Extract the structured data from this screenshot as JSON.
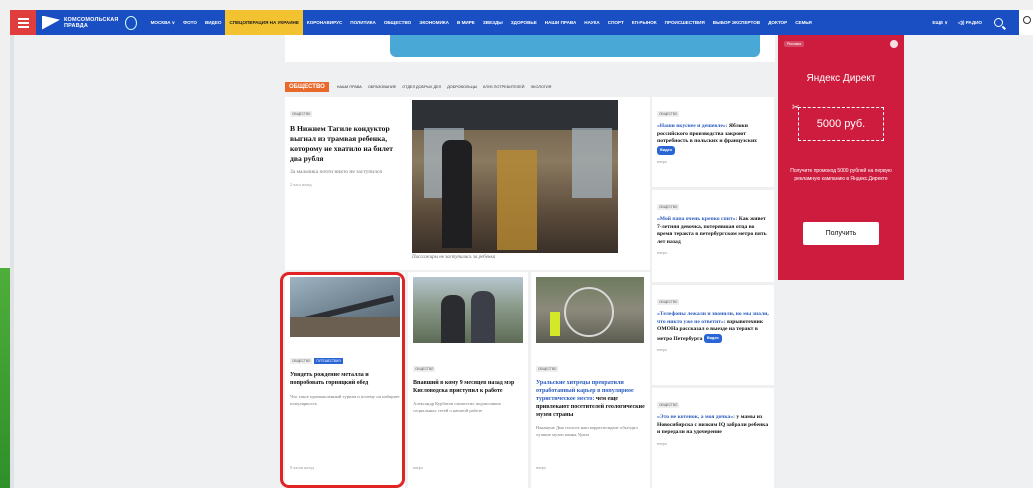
{
  "nav": {
    "items": [
      {
        "label": "Москва ∨",
        "hl": false
      },
      {
        "label": "Фото",
        "hl": false
      },
      {
        "label": "Видео",
        "hl": false
      },
      {
        "label": "Спецоперация на Украине",
        "hl": true
      },
      {
        "label": "Коронавирус",
        "hl": false
      },
      {
        "label": "Политика",
        "hl": false
      },
      {
        "label": "Общество",
        "hl": false
      },
      {
        "label": "Экономика",
        "hl": false
      },
      {
        "label": "В мире",
        "hl": false
      },
      {
        "label": "Звезды",
        "hl": false
      },
      {
        "label": "Здоровье",
        "hl": false
      },
      {
        "label": "Наши права",
        "hl": false
      },
      {
        "label": "Наука",
        "hl": false
      },
      {
        "label": "Спорт",
        "hl": false
      },
      {
        "label": "Кп-рынок",
        "hl": false
      },
      {
        "label": "Происшествия",
        "hl": false
      },
      {
        "label": "Выбор экспертов",
        "hl": false
      },
      {
        "label": "Доктор",
        "hl": false
      },
      {
        "label": "Семья",
        "hl": false
      }
    ],
    "more": "Еще ∨",
    "radio": "◁)) Радио",
    "logo_line1": "Комсомольская",
    "logo_line2": "правда"
  },
  "section": {
    "badge": "Общество",
    "tabs": [
      "Наши права",
      "Образование",
      "Отдел добрых дел",
      "Добровольцы",
      "Клуб потребителей",
      "Экология"
    ]
  },
  "main_article": {
    "tag": "Общество",
    "title": "В Нижнем Тагиле кондуктор выгнал из трамвая ребенка, которому не хватило на билет два рубля",
    "subtitle": "За мальчика почти никто не заступился",
    "time": "2 часа назад",
    "photo_caption": "Пассажиры не заступились за ребенка"
  },
  "side_news": [
    {
      "tag": "Общество",
      "quote": "«Наши вкуснее и дешевле»:",
      "rest": "Яблоки российского производства закроют потребность в польских и французских",
      "video": "Видео",
      "time": "вчера"
    },
    {
      "tag": "Общество",
      "quote": "«Мой папа очень крепко спит»:",
      "rest": "Как живет 7-летняя девочка, потерявшая отца во время теракта в петербургском метро пять лет назад",
      "video": "",
      "time": "вчера"
    },
    {
      "tag": "Общество",
      "quote": "«Телефоны лежали и звонили, но мы знали, что никто уже не ответит»:",
      "rest": "взрывотехник ОМОНа рассказал о выезде на теракт в метро Петербурга",
      "video": "Видео",
      "time": "вчера"
    },
    {
      "tag": "Общество",
      "quote": "«Это не котенок, а моя дочка»:",
      "rest": "у мамы из Новосибирска с низким IQ забрали ребенка и передали на удочерение",
      "video": "",
      "time": "вчера"
    }
  ],
  "bottom_cards": [
    {
      "tags": [
        "Общество",
        "Путешествия"
      ],
      "title": "Увидеть рождение металла и попробовать горняцкий обед",
      "sub": "Что такое промышленный туризм и почему он набирает популярность",
      "time": "8 часов назад"
    },
    {
      "tags": [
        "Общество"
      ],
      "title": "Впавший в кому 9 месяцев назад мэр Кисловодска приступил к работе",
      "sub": "Александр Курбатов оповестил подписчиков социальных сетей о начатой работе",
      "time": "вчера"
    },
    {
      "tags": [
        "Общество"
      ],
      "title_blue": "Уральские хитрецы превратили отработанный карьер в популярное туристическое место:",
      "title": "чем еще привлекают посетителей геологические музеи страны",
      "sub": "Накануне Дня геолога наш корреспондент обьездил лучшие музеи камня Урала",
      "time": "вчера"
    }
  ],
  "ad": {
    "label": "Реклама",
    "title": "Яндекс Директ",
    "coupon": "5000 руб.",
    "desc": "Получите промокод 5000 рублей на первую рекламную кампанию в Яндекс.Директе",
    "button": "Получить"
  },
  "colors": {
    "nav": "#1a4fc4",
    "highlight": "#f2c230",
    "section_badge": "#e8692a",
    "ad": "#ce1c3f",
    "outline": "#e02424"
  }
}
